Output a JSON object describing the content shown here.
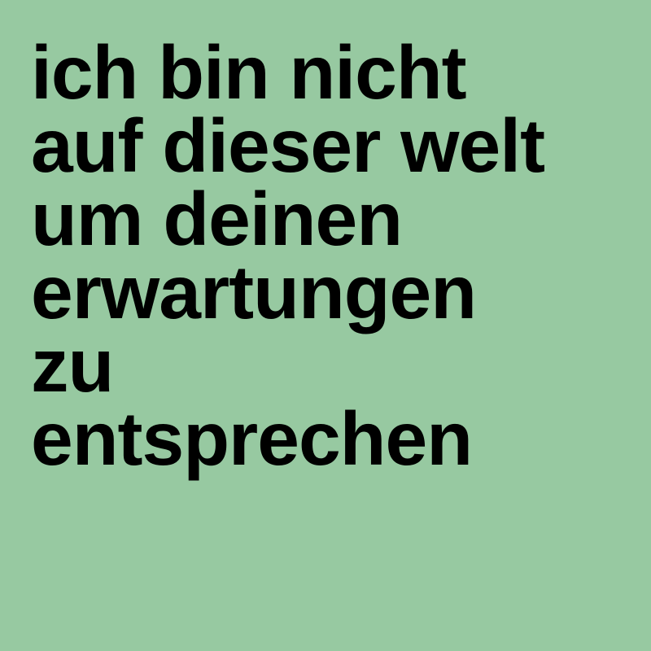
{
  "colors": {
    "background": "#97c9a1",
    "text": "#000000"
  },
  "quote": {
    "lines": [
      "ich bin nicht",
      "auf dieser welt",
      "um deinen",
      "erwartungen",
      "zu",
      "entsprechen"
    ]
  }
}
